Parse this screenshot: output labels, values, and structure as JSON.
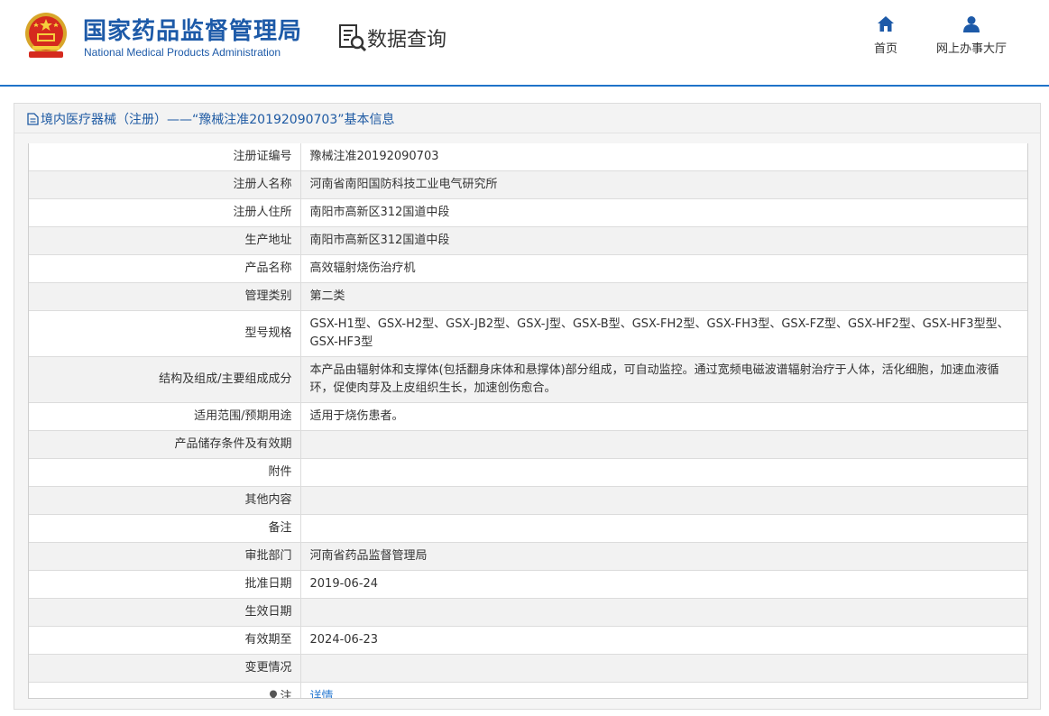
{
  "header": {
    "org_name_cn": "国家药品监督管理局",
    "org_name_en": "National Medical Products Administration",
    "section_title": "数据查询",
    "nav": [
      {
        "label": "首页",
        "icon": "home-icon"
      },
      {
        "label": "网上办事大厅",
        "icon": "user-icon"
      }
    ],
    "accent_color": "#1f73c9"
  },
  "panel": {
    "title": "境内医疗器械（注册）——“豫械注准20192090703”基本信息"
  },
  "rows": [
    {
      "label": "注册证编号",
      "value": "豫械注准20192090703"
    },
    {
      "label": "注册人名称",
      "value": "河南省南阳国防科技工业电气研究所"
    },
    {
      "label": "注册人住所",
      "value": "南阳市高新区312国道中段"
    },
    {
      "label": "生产地址",
      "value": "南阳市高新区312国道中段"
    },
    {
      "label": "产品名称",
      "value": "高效辐射烧伤治疗机"
    },
    {
      "label": "管理类别",
      "value": "第二类"
    },
    {
      "label": "型号规格",
      "value": "GSX-H1型、GSX-H2型、GSX-JB2型、GSX-J型、GSX-B型、GSX-FH2型、GSX-FH3型、GSX-FZ型、GSX-HF2型、GSX-HF3型型、GSX-HF3型"
    },
    {
      "label": "结构及组成/主要组成成分",
      "value": "本产品由辐射体和支撑体(包括翻身床体和悬撑体)部分组成，可自动监控。通过宽频电磁波谱辐射治疗于人体，活化细胞，加速血液循环，促使肉芽及上皮组织生长，加速创伤愈合。"
    },
    {
      "label": "适用范围/预期用途",
      "value": "适用于烧伤患者。"
    },
    {
      "label": "产品储存条件及有效期",
      "value": ""
    },
    {
      "label": "附件",
      "value": ""
    },
    {
      "label": "其他内容",
      "value": ""
    },
    {
      "label": "备注",
      "value": ""
    },
    {
      "label": "审批部门",
      "value": "河南省药品监督管理局"
    },
    {
      "label": "批准日期",
      "value": "2019-06-24"
    },
    {
      "label": "生效日期",
      "value": ""
    },
    {
      "label": "有效期至",
      "value": "2024-06-23"
    },
    {
      "label": "变更情况",
      "value": ""
    },
    {
      "label": "注",
      "value": "详情"
    }
  ]
}
